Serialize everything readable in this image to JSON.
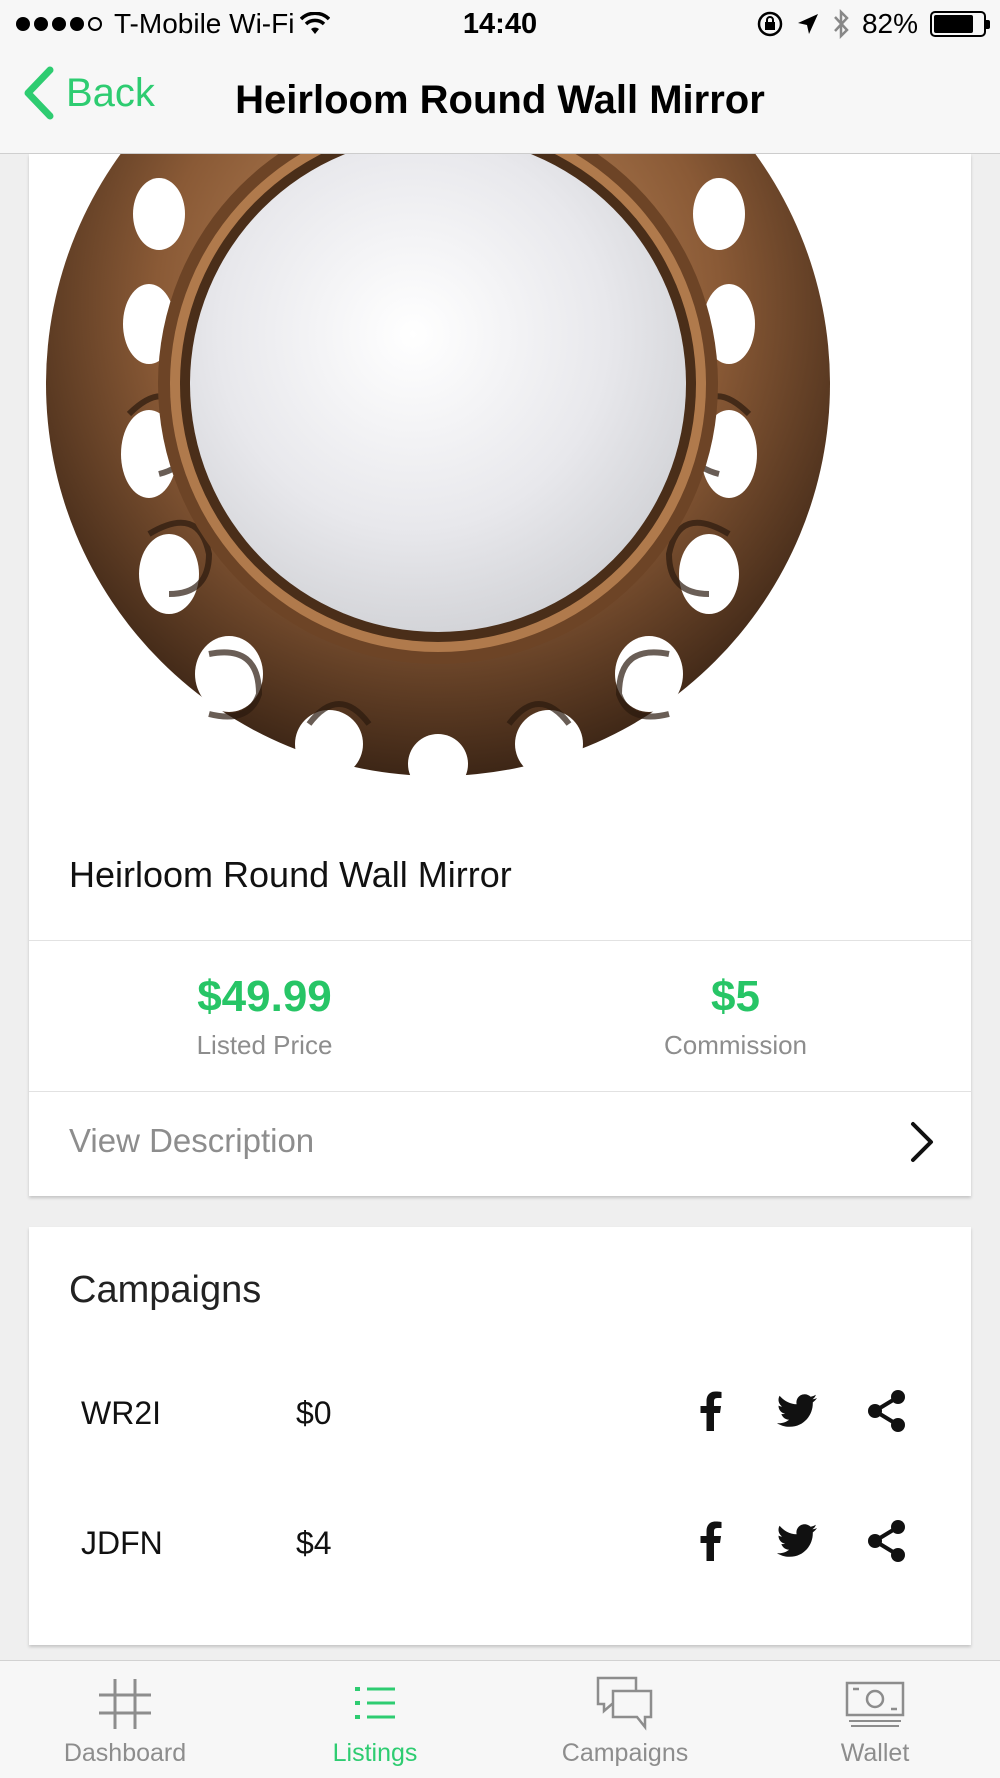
{
  "status_bar": {
    "carrier": "T-Mobile Wi-Fi",
    "time": "14:40",
    "battery": "82%",
    "battery_level": 0.82
  },
  "nav": {
    "back_label": "Back",
    "title": "Heirloom Round Wall Mirror"
  },
  "product": {
    "name": "Heirloom Round Wall Mirror",
    "listed_price": "$49.99",
    "listed_price_label": "Listed Price",
    "commission": "$5",
    "commission_label": "Commission",
    "view_description_label": "View Description"
  },
  "campaigns": {
    "title": "Campaigns",
    "rows": [
      {
        "code": "WR2I",
        "amount": "$0"
      },
      {
        "code": "JDFN",
        "amount": "$4"
      }
    ]
  },
  "tabs": [
    {
      "label": "Dashboard",
      "icon": "grid-icon"
    },
    {
      "label": "Listings",
      "icon": "list-icon"
    },
    {
      "label": "Campaigns",
      "icon": "chat-bubbles-icon"
    },
    {
      "label": "Wallet",
      "icon": "banknote-icon"
    }
  ],
  "colors": {
    "accent": "#2ecc71",
    "price": "#27c566"
  }
}
